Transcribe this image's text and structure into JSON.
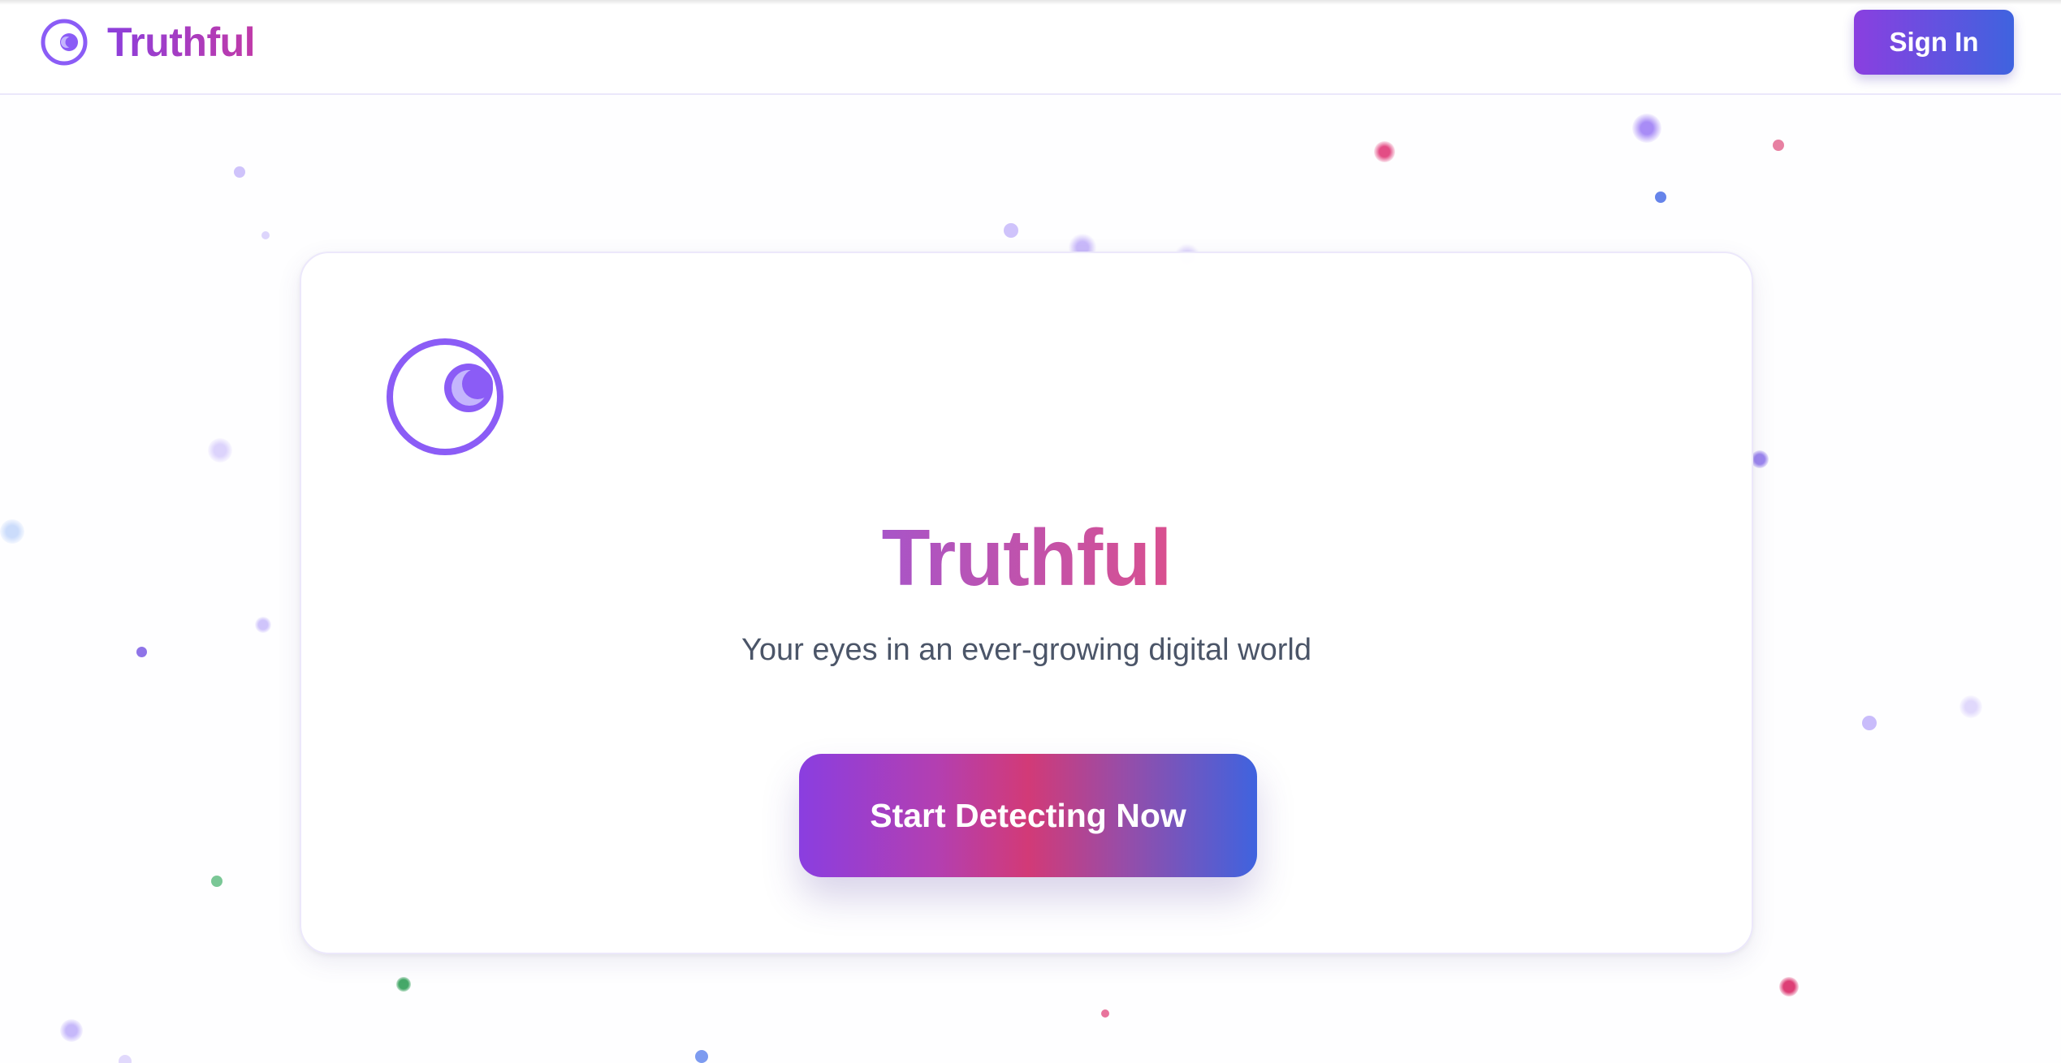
{
  "header": {
    "brand_name": "Truthful",
    "brand_icon": "eye-moon-icon",
    "signin_label": "Sign In"
  },
  "hero": {
    "icon": "eye-moon-icon",
    "title": "Truthful",
    "tagline": "Your eyes in an ever-growing digital world",
    "cta_label": "Start Detecting Now"
  },
  "colors": {
    "brand_purple": "#8b5cf6",
    "gradient_start": "#8a3fe0",
    "gradient_mid": "#d23a77",
    "gradient_end": "#3f63df",
    "text_muted": "#4b5568"
  }
}
